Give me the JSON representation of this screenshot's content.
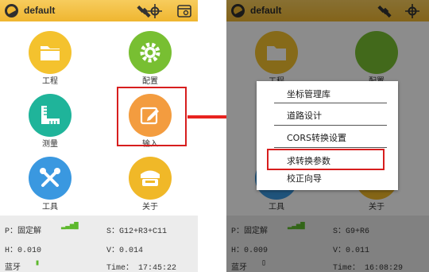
{
  "left": {
    "title": "default",
    "tiles": [
      {
        "label": "工程",
        "icon": "folder-icon"
      },
      {
        "label": "配置",
        "icon": "gear-icon"
      },
      {
        "label": "测量",
        "icon": "ruler-icon"
      },
      {
        "label": "输入",
        "icon": "edit-icon"
      },
      {
        "label": "工具",
        "icon": "tools-icon"
      },
      {
        "label": "关于",
        "icon": "receiver-icon"
      }
    ],
    "status": {
      "p": "P：固定解",
      "s": "S：G12+R3+C11",
      "h": "H：0.010",
      "v": "V：0.014",
      "bt": "蓝牙",
      "time": "Time： 17:45:22"
    }
  },
  "right": {
    "title": "default",
    "tiles": [
      {
        "label": "工程",
        "icon": "folder-icon"
      },
      {
        "label": "配置",
        "icon": "gear-icon"
      },
      {
        "label": "工具",
        "icon": "tools-icon"
      },
      {
        "label": "关于",
        "icon": "receiver-icon"
      }
    ],
    "menu": [
      {
        "label": "坐标管理库"
      },
      {
        "label": "道路设计"
      },
      {
        "label": "CORS转换设置"
      },
      {
        "label": "求转换参数"
      },
      {
        "label": "校正向导"
      }
    ],
    "status": {
      "p": "P：固定解",
      "s": "S：G9+R6",
      "h": "H：0.009",
      "v": "V：0.011",
      "bt": "蓝牙",
      "time": "Time： 16:08:29"
    }
  },
  "colors": {
    "accent": "#efb630",
    "highlight": "#d71e1e",
    "arrow": "#e8231f"
  }
}
